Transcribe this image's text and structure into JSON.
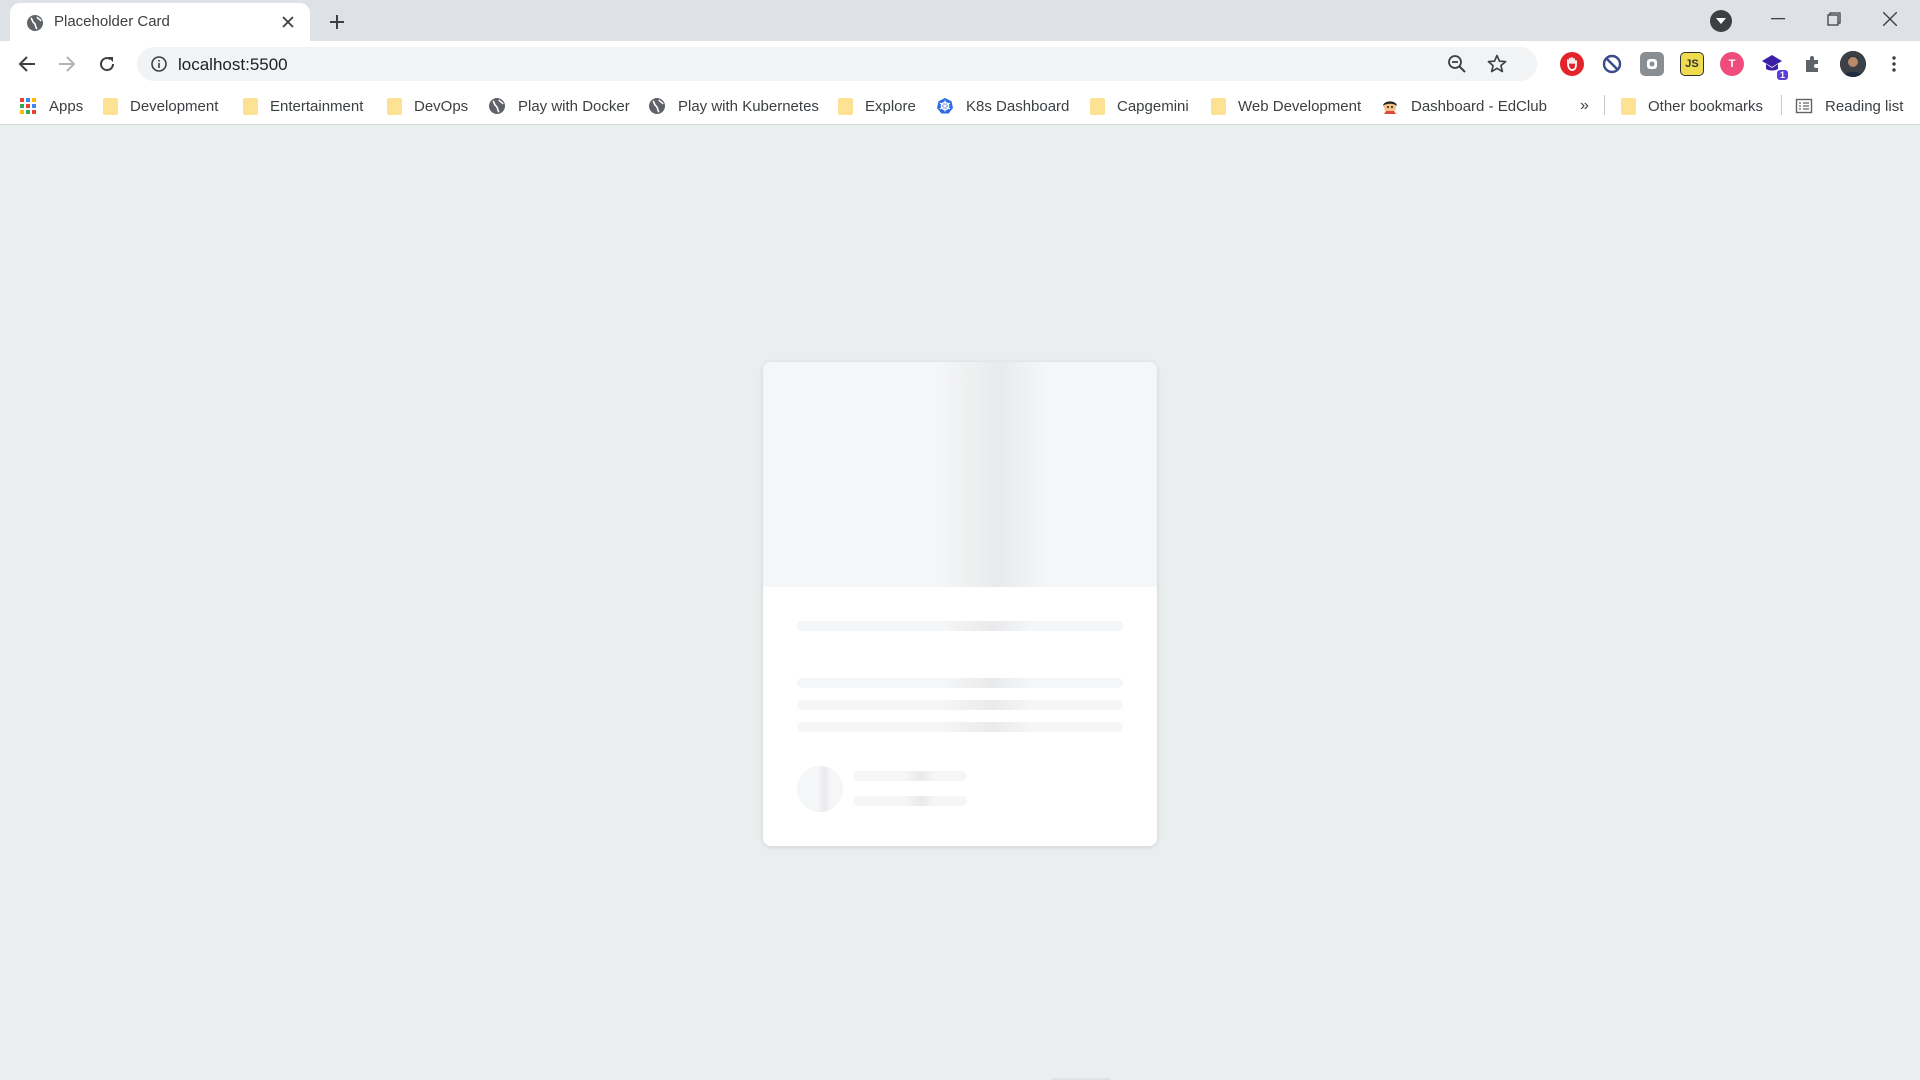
{
  "tab": {
    "title": "Placeholder Card",
    "favicon": "globe-icon"
  },
  "toolbar": {
    "url": "localhost:5500"
  },
  "extensions": [
    {
      "name": "adblock-extension-icon",
      "bg": "#e3242b",
      "label": ""
    },
    {
      "name": "blocker-extension-icon",
      "bg": "#ffffff",
      "label": ""
    },
    {
      "name": "gray-extension-icon",
      "bg": "#8a8d91",
      "label": ""
    },
    {
      "name": "js-extension-icon",
      "bg": "#f0db4f",
      "label": "JS"
    },
    {
      "name": "t-extension-icon",
      "bg": "#ee4c7c",
      "label": "T"
    },
    {
      "name": "grad-cap-extension-icon",
      "bg": "#ffffff",
      "label": "1"
    }
  ],
  "bookmarks": {
    "apps": "Apps",
    "items": [
      {
        "label": "Development",
        "icon": "folder-icon"
      },
      {
        "label": "Entertainment",
        "icon": "folder-icon"
      },
      {
        "label": "DevOps",
        "icon": "folder-icon"
      },
      {
        "label": "Play with Docker",
        "icon": "globe-icon"
      },
      {
        "label": "Play with Kubernetes",
        "icon": "globe-icon"
      },
      {
        "label": "Explore",
        "icon": "folder-icon"
      },
      {
        "label": "K8s Dashboard",
        "icon": "kubernetes-icon"
      },
      {
        "label": "Capgemini",
        "icon": "folder-icon"
      },
      {
        "label": "Web Development",
        "icon": "folder-icon"
      },
      {
        "label": "Dashboard - EdClub",
        "icon": "edclub-icon"
      }
    ],
    "overflow": "»",
    "other": "Other bookmarks",
    "reading_list": "Reading list"
  },
  "colors": {
    "page_bg": "#ebeeef",
    "card_bg": "#ffffff",
    "skeleton": "#f5f6f7"
  }
}
